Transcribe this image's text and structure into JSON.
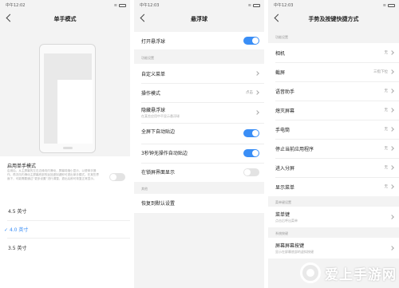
{
  "panel_left": {
    "status": {
      "time": "中午12:02"
    },
    "title": "单手模式",
    "enable_label": "启用单手模式",
    "description": "启用后，从主屏幕的左右边缘向内滑动，屏幕将缩小显示，以便单手操作。再次向内滑动主屏幕底部的返回虚拟键即可退出单手模式。在某些界面下，可能需要通过“更多设置”进行调整，退出后即可恢复正常显示。",
    "sizes": [
      {
        "label": "4.5 英寸",
        "selected": false
      },
      {
        "label": "4.0 英寸",
        "selected": true
      },
      {
        "label": "3.5 英寸",
        "selected": false
      }
    ],
    "accent": "#3a8ef6"
  },
  "panel_middle": {
    "status": {
      "time": "中午12:03"
    },
    "title": "悬浮球",
    "open_label": "打开悬浮球",
    "section_function": "功能设置",
    "custom_menu": "自定义菜单",
    "action_mode": "操作模式",
    "action_mode_value": "点击",
    "hide_ball": "隐藏悬浮球",
    "hide_ball_sub": "在某些应用中不显示悬浮球",
    "fullscreen_snap": "全屏下自动贴边",
    "idle_snap": "3秒钟无操作自动贴边",
    "lockscreen_show": "在锁屏界面显示",
    "section_other": "其他",
    "restore_default": "恢复到默认设置"
  },
  "panel_right": {
    "status": {
      "time": "中午12:03"
    },
    "title": "手势及按键快捷方式",
    "section_function": "功能设置",
    "items": [
      {
        "label": "相机",
        "value": "无"
      },
      {
        "label": "截屏",
        "value": "三指下拉"
      },
      {
        "label": "语音助手",
        "value": "无"
      },
      {
        "label": "熄灭屏幕",
        "value": "无"
      },
      {
        "label": "手电筒",
        "value": "无"
      },
      {
        "label": "停止当前应用程序",
        "value": "无"
      },
      {
        "label": "进入分屏",
        "value": "无"
      },
      {
        "label": "显示菜单",
        "value": "无"
      }
    ],
    "section_menu": "菜单键设置",
    "menu_key": "菜单键",
    "menu_key_sub": "点击后呼出菜单",
    "section_system": "系统按键",
    "screen_key": "屏幕屏幕按键",
    "screen_key_sub": "显示在屏幕底部的虚拟按键"
  },
  "watermark": {
    "text": "爱上手游网"
  }
}
